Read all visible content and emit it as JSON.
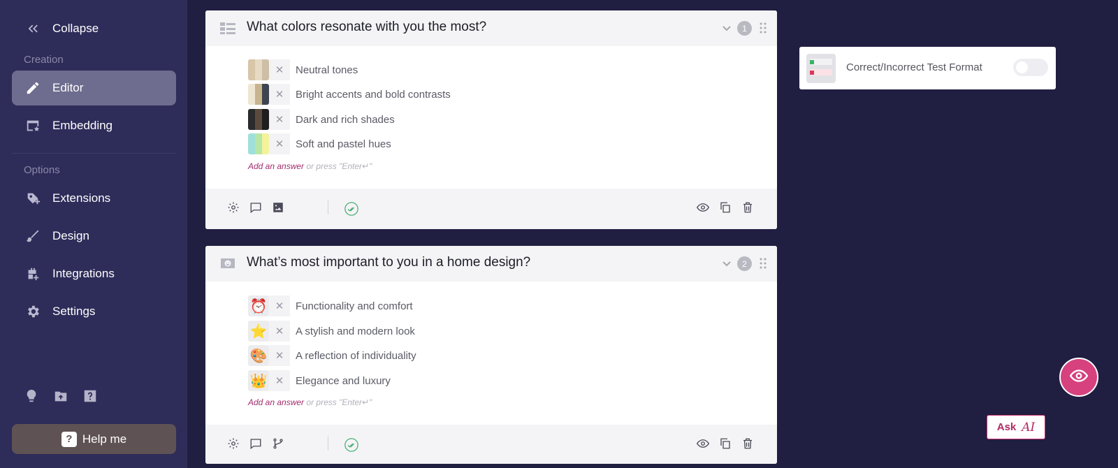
{
  "sidebar": {
    "collapse_label": "Collapse",
    "section_creation": "Creation",
    "section_options": "Options",
    "items": [
      {
        "label": "Editor"
      },
      {
        "label": "Embedding"
      },
      {
        "label": "Extensions"
      },
      {
        "label": "Design"
      },
      {
        "label": "Integrations"
      },
      {
        "label": "Settings"
      }
    ],
    "help_label": "Help me"
  },
  "questions": [
    {
      "number": "1",
      "title": "What colors resonate with you the most?",
      "answers": [
        {
          "text": "Neutral tones",
          "swatch": [
            "#d8c6a8",
            "#e7dac4",
            "#cdbfa5"
          ]
        },
        {
          "text": "Bright accents and bold contrasts",
          "swatch": [
            "#efe6d2",
            "#c8b490",
            "#3e4550"
          ]
        },
        {
          "text": "Dark and rich shades",
          "swatch": [
            "#2b2a2c",
            "#5b4a3e",
            "#1e1e20"
          ]
        },
        {
          "text": "Soft and pastel hues",
          "swatch": [
            "#9fe0d9",
            "#b8e6a6",
            "#f4f29a"
          ]
        }
      ],
      "add_answer_link": "Add an answer",
      "add_answer_hint": " or press \"Enter↵\""
    },
    {
      "number": "2",
      "title": "What’s most important to you in a home design?",
      "answers": [
        {
          "text": "Functionality and comfort",
          "emoji": "⏰"
        },
        {
          "text": "A stylish and modern look",
          "emoji": "⭐"
        },
        {
          "text": "A reflection of individuality",
          "emoji": "🎨"
        },
        {
          "text": "Elegance and luxury",
          "emoji": "👑"
        }
      ],
      "add_answer_link": "Add an answer",
      "add_answer_hint": " or press \"Enter↵\""
    }
  ],
  "format_option": {
    "label": "Correct/Incorrect Test Format",
    "enabled": false
  },
  "ask_button": {
    "label": "Ask",
    "ai_glyph": "AI"
  },
  "colors": {
    "accent": "#d6417e",
    "sidebar": "#2e2c59",
    "background": "#201e41",
    "success": "#4caf76"
  },
  "icons": [
    "chevrons-left-icon",
    "pencil-icon",
    "embed-icon",
    "puzzle-icon",
    "brush-icon",
    "plug-icon",
    "gear-icon",
    "lightbulb-icon",
    "upload-folder-icon",
    "question-icon",
    "eye-icon",
    "copy-icon",
    "trash-icon",
    "comment-icon",
    "image-icon",
    "branch-icon",
    "double-check-icon",
    "drag-handle-icon"
  ]
}
